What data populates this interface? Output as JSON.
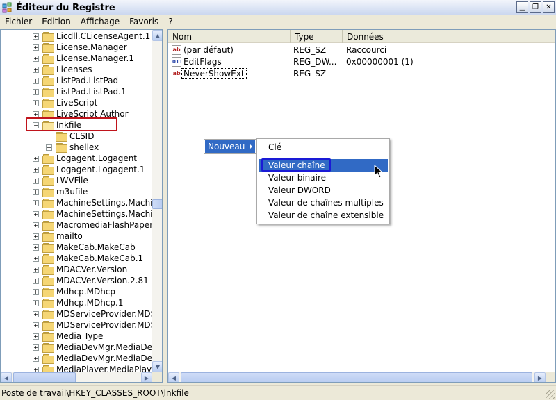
{
  "window": {
    "title": "Éditeur du Registre",
    "controls": [
      "minimize",
      "maximize",
      "close"
    ]
  },
  "menu": [
    "Fichier",
    "Edition",
    "Affichage",
    "Favoris",
    "?"
  ],
  "tree": {
    "items": [
      {
        "label": "Licdll.CLicenseAgent.1",
        "expander": "+",
        "level": 1
      },
      {
        "label": "License.Manager",
        "expander": "+",
        "level": 1
      },
      {
        "label": "License.Manager.1",
        "expander": "+",
        "level": 1
      },
      {
        "label": "Licenses",
        "expander": "+",
        "level": 1
      },
      {
        "label": "ListPad.ListPad",
        "expander": "+",
        "level": 1
      },
      {
        "label": "ListPad.ListPad.1",
        "expander": "+",
        "level": 1
      },
      {
        "label": "LiveScript",
        "expander": "+",
        "level": 1
      },
      {
        "label": "LiveScript Author",
        "expander": "+",
        "level": 1
      },
      {
        "label": "lnkfile",
        "expander": "−",
        "level": 1,
        "open": true
      },
      {
        "label": "CLSID",
        "expander": "",
        "level": 2
      },
      {
        "label": "shellex",
        "expander": "+",
        "level": 2
      },
      {
        "label": "Logagent.Logagent",
        "expander": "+",
        "level": 1
      },
      {
        "label": "Logagent.Logagent.1",
        "expander": "+",
        "level": 1
      },
      {
        "label": "LWVFile",
        "expander": "+",
        "level": 1
      },
      {
        "label": "m3ufile",
        "expander": "+",
        "level": 1
      },
      {
        "label": "MachineSettings.Machine",
        "expander": "+",
        "level": 1
      },
      {
        "label": "MachineSettings.Machine",
        "expander": "+",
        "level": 1
      },
      {
        "label": "MacromediaFlashPaper.Ma",
        "expander": "+",
        "level": 1
      },
      {
        "label": "mailto",
        "expander": "+",
        "level": 1
      },
      {
        "label": "MakeCab.MakeCab",
        "expander": "+",
        "level": 1
      },
      {
        "label": "MakeCab.MakeCab.1",
        "expander": "+",
        "level": 1
      },
      {
        "label": "MDACVer.Version",
        "expander": "+",
        "level": 1
      },
      {
        "label": "MDACVer.Version.2.81",
        "expander": "+",
        "level": 1
      },
      {
        "label": "Mdhcp.MDhcp",
        "expander": "+",
        "level": 1
      },
      {
        "label": "Mdhcp.MDhcp.1",
        "expander": "+",
        "level": 1
      },
      {
        "label": "MDServiceProvider.MDSe",
        "expander": "+",
        "level": 1
      },
      {
        "label": "MDServiceProvider.MDSe",
        "expander": "+",
        "level": 1
      },
      {
        "label": "Media Type",
        "expander": "+",
        "level": 1
      },
      {
        "label": "MediaDevMgr.MediaDevM",
        "expander": "+",
        "level": 1
      },
      {
        "label": "MediaDevMgr.MediaDevM",
        "expander": "+",
        "level": 1
      },
      {
        "label": "MediaPlayer.MediaPlayer",
        "expander": "+",
        "level": 1
      }
    ]
  },
  "list": {
    "columns": [
      "Nom",
      "Type",
      "Données"
    ],
    "rows": [
      {
        "icon": "ab",
        "icon_kind": "string-value-icon",
        "name": "(par défaut)",
        "type": "REG_SZ",
        "data": "Raccourci"
      },
      {
        "icon": "011",
        "icon_kind": "binary-value-icon",
        "name": "EditFlags",
        "type": "REG_DW...",
        "data": "0x00000001 (1)"
      },
      {
        "icon": "ab",
        "icon_kind": "string-value-icon",
        "name": "NeverShowExt",
        "type": "REG_SZ",
        "data": ""
      }
    ]
  },
  "context_menu": {
    "parent_label": "Nouveau",
    "items": [
      "Clé",
      "Valeur chaîne",
      "Valeur binaire",
      "Valeur DWORD",
      "Valeur de chaînes multiples",
      "Valeur de chaîne extensible"
    ]
  },
  "status": "Poste de travail\\HKEY_CLASSES_ROOT\\lnkfile",
  "colors": {
    "highlight": "#316ac5",
    "annotation_red": "#c0141c",
    "annotation_blue": "#1a1ad6"
  }
}
